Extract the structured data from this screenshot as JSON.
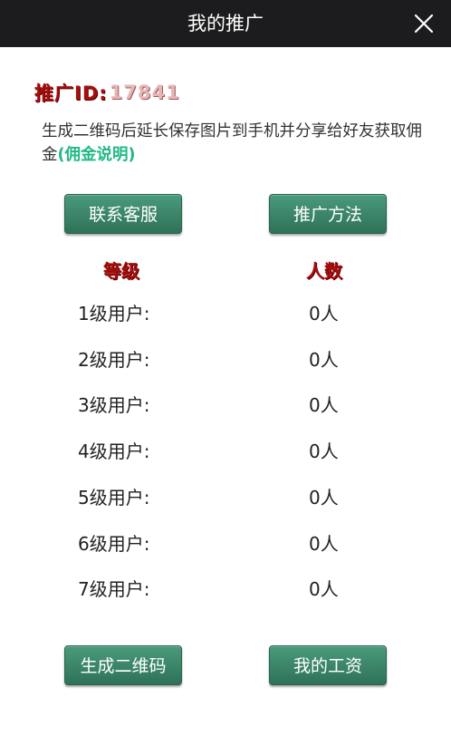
{
  "header": {
    "title": "我的推广",
    "close_icon": "close-icon"
  },
  "promo": {
    "id_label": "推广ID:",
    "id_value": "17841"
  },
  "description": {
    "text": "生成二维码后延长保存图片到手机并分享给好友获取佣金",
    "link": "(佣金说明)"
  },
  "buttons": {
    "contact": "联系客服",
    "method": "推广方法",
    "qrcode": "生成二维码",
    "salary": "我的工资"
  },
  "table": {
    "headers": [
      "等级",
      "人数"
    ],
    "rows": [
      {
        "level": "1级用户:",
        "count": "0人"
      },
      {
        "level": "2级用户:",
        "count": "0人"
      },
      {
        "level": "3级用户:",
        "count": "0人"
      },
      {
        "level": "4级用户:",
        "count": "0人"
      },
      {
        "level": "5级用户:",
        "count": "0人"
      },
      {
        "level": "6级用户:",
        "count": "0人"
      },
      {
        "level": "7级用户:",
        "count": "0人"
      }
    ]
  },
  "colors": {
    "topbar": "#1c1c1e",
    "button": "#3a8469",
    "heading_red": "#a80d0d",
    "link_green": "#1fb987"
  }
}
